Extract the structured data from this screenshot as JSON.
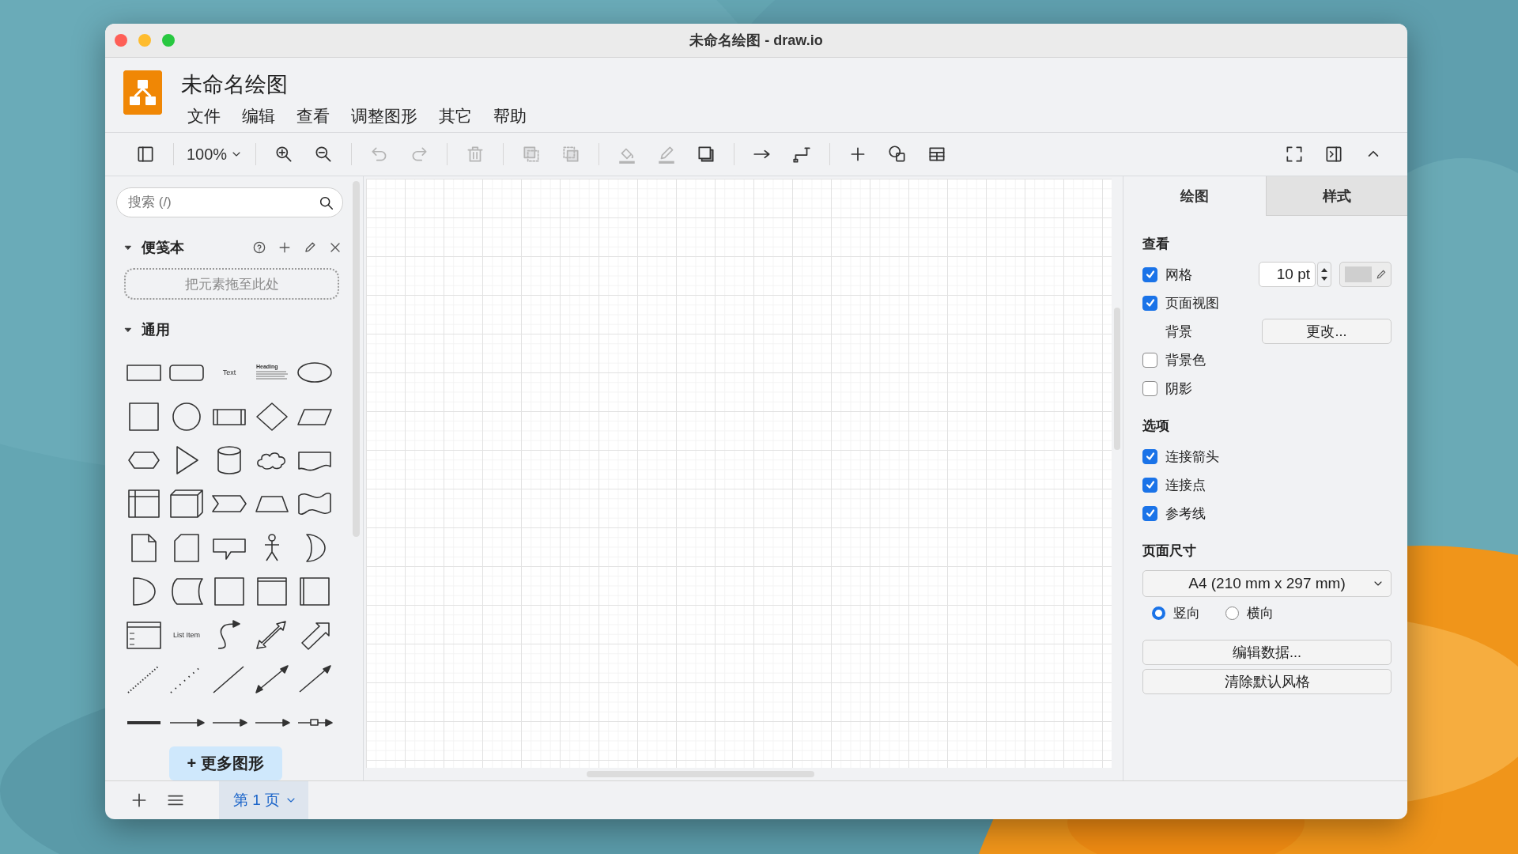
{
  "window": {
    "title": "未命名绘图 - draw.io"
  },
  "header": {
    "document_title": "未命名绘图",
    "menu": [
      "文件",
      "编辑",
      "查看",
      "调整图形",
      "其它",
      "帮助"
    ]
  },
  "toolbar": {
    "items": [
      {
        "kind": "sidebar",
        "disabled": false
      },
      {
        "kind": "separator"
      },
      {
        "kind": "zoom",
        "label": "100%",
        "disabled": false
      },
      {
        "kind": "separator"
      },
      {
        "kind": "zoom_in",
        "disabled": false
      },
      {
        "kind": "zoom_out",
        "disabled": false
      },
      {
        "kind": "separator"
      },
      {
        "kind": "undo",
        "disabled": true
      },
      {
        "kind": "redo",
        "disabled": true
      },
      {
        "kind": "separator"
      },
      {
        "kind": "delete",
        "disabled": true
      },
      {
        "kind": "separator"
      },
      {
        "kind": "to_front",
        "disabled": true
      },
      {
        "kind": "to_back",
        "disabled": true
      },
      {
        "kind": "separator"
      },
      {
        "kind": "fill_color",
        "disabled": true
      },
      {
        "kind": "line_color",
        "disabled": true
      },
      {
        "kind": "shadow",
        "disabled": false
      },
      {
        "kind": "separator"
      },
      {
        "kind": "connection",
        "disabled": false
      },
      {
        "kind": "waypoints",
        "disabled": false
      },
      {
        "kind": "separator"
      },
      {
        "kind": "insert",
        "disabled": false
      },
      {
        "kind": "shapes",
        "disabled": false
      },
      {
        "kind": "table",
        "disabled": false
      },
      {
        "kind": "spacer"
      },
      {
        "kind": "fullscreen",
        "disabled": false
      },
      {
        "kind": "format_panel",
        "disabled": false
      },
      {
        "kind": "collapse",
        "disabled": false
      }
    ]
  },
  "sidebar": {
    "search": {
      "placeholder": "搜索 (/)"
    },
    "sections": [
      {
        "kind": "scratchpad",
        "title": "便笺本",
        "expanded": true,
        "drop_hint": "把元素拖至此处"
      },
      {
        "kind": "shapes",
        "title": "通用",
        "expanded": true,
        "shape_texts": [
          "Text",
          "Heading",
          "List Item"
        ]
      }
    ],
    "more_shapes": "+ 更多图形"
  },
  "format_panel": {
    "tabs": [
      {
        "label": "绘图",
        "selected": true
      },
      {
        "label": "样式",
        "selected": false
      }
    ],
    "sections": [
      {
        "title": "查看",
        "rows": [
          {
            "kind": "checkbox_field",
            "label": "网格",
            "checked": true,
            "value": "10 pt"
          },
          {
            "kind": "checkbox",
            "label": "页面视图",
            "checked": true
          },
          {
            "kind": "label_button",
            "label": "背景",
            "button": "更改..."
          },
          {
            "kind": "checkbox",
            "label": "背景色",
            "checked": false
          },
          {
            "kind": "checkbox",
            "label": "阴影",
            "checked": false
          }
        ]
      },
      {
        "title": "选项",
        "rows": [
          {
            "kind": "checkbox",
            "label": "连接箭头",
            "checked": true
          },
          {
            "kind": "checkbox",
            "label": "连接点",
            "checked": true
          },
          {
            "kind": "checkbox",
            "label": "参考线",
            "checked": true
          }
        ]
      },
      {
        "title": "页面尺寸",
        "rows": [
          {
            "kind": "select",
            "value": "A4 (210 mm x 297 mm)"
          },
          {
            "kind": "radios",
            "options": [
              {
                "label": "竖向",
                "selected": true
              },
              {
                "label": "横向",
                "selected": false
              }
            ]
          }
        ]
      }
    ],
    "buttons": [
      "编辑数据...",
      "清除默认风格"
    ]
  },
  "pages": {
    "tabs": [
      {
        "label": "第 1 页",
        "selected": true
      }
    ]
  }
}
